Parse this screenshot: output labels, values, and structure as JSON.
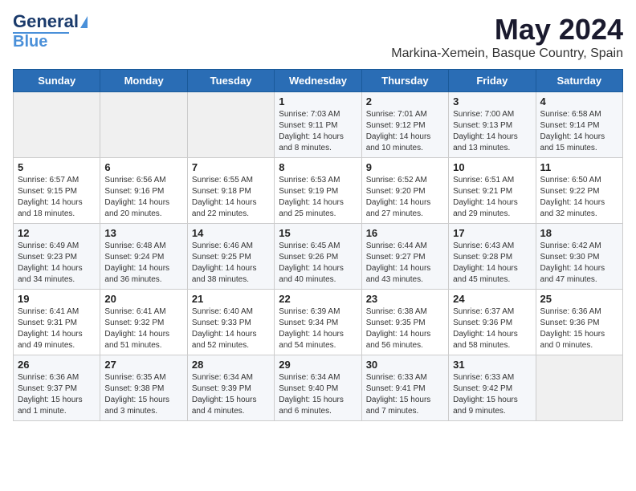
{
  "logo": {
    "line1": "General",
    "line2": "Blue"
  },
  "title": "May 2024",
  "subtitle": "Markina-Xemein, Basque Country, Spain",
  "days_header": [
    "Sunday",
    "Monday",
    "Tuesday",
    "Wednesday",
    "Thursday",
    "Friday",
    "Saturday"
  ],
  "weeks": [
    [
      {
        "day": "",
        "info": ""
      },
      {
        "day": "",
        "info": ""
      },
      {
        "day": "",
        "info": ""
      },
      {
        "day": "1",
        "info": "Sunrise: 7:03 AM\nSunset: 9:11 PM\nDaylight: 14 hours\nand 8 minutes."
      },
      {
        "day": "2",
        "info": "Sunrise: 7:01 AM\nSunset: 9:12 PM\nDaylight: 14 hours\nand 10 minutes."
      },
      {
        "day": "3",
        "info": "Sunrise: 7:00 AM\nSunset: 9:13 PM\nDaylight: 14 hours\nand 13 minutes."
      },
      {
        "day": "4",
        "info": "Sunrise: 6:58 AM\nSunset: 9:14 PM\nDaylight: 14 hours\nand 15 minutes."
      }
    ],
    [
      {
        "day": "5",
        "info": "Sunrise: 6:57 AM\nSunset: 9:15 PM\nDaylight: 14 hours\nand 18 minutes."
      },
      {
        "day": "6",
        "info": "Sunrise: 6:56 AM\nSunset: 9:16 PM\nDaylight: 14 hours\nand 20 minutes."
      },
      {
        "day": "7",
        "info": "Sunrise: 6:55 AM\nSunset: 9:18 PM\nDaylight: 14 hours\nand 22 minutes."
      },
      {
        "day": "8",
        "info": "Sunrise: 6:53 AM\nSunset: 9:19 PM\nDaylight: 14 hours\nand 25 minutes."
      },
      {
        "day": "9",
        "info": "Sunrise: 6:52 AM\nSunset: 9:20 PM\nDaylight: 14 hours\nand 27 minutes."
      },
      {
        "day": "10",
        "info": "Sunrise: 6:51 AM\nSunset: 9:21 PM\nDaylight: 14 hours\nand 29 minutes."
      },
      {
        "day": "11",
        "info": "Sunrise: 6:50 AM\nSunset: 9:22 PM\nDaylight: 14 hours\nand 32 minutes."
      }
    ],
    [
      {
        "day": "12",
        "info": "Sunrise: 6:49 AM\nSunset: 9:23 PM\nDaylight: 14 hours\nand 34 minutes."
      },
      {
        "day": "13",
        "info": "Sunrise: 6:48 AM\nSunset: 9:24 PM\nDaylight: 14 hours\nand 36 minutes."
      },
      {
        "day": "14",
        "info": "Sunrise: 6:46 AM\nSunset: 9:25 PM\nDaylight: 14 hours\nand 38 minutes."
      },
      {
        "day": "15",
        "info": "Sunrise: 6:45 AM\nSunset: 9:26 PM\nDaylight: 14 hours\nand 40 minutes."
      },
      {
        "day": "16",
        "info": "Sunrise: 6:44 AM\nSunset: 9:27 PM\nDaylight: 14 hours\nand 43 minutes."
      },
      {
        "day": "17",
        "info": "Sunrise: 6:43 AM\nSunset: 9:28 PM\nDaylight: 14 hours\nand 45 minutes."
      },
      {
        "day": "18",
        "info": "Sunrise: 6:42 AM\nSunset: 9:30 PM\nDaylight: 14 hours\nand 47 minutes."
      }
    ],
    [
      {
        "day": "19",
        "info": "Sunrise: 6:41 AM\nSunset: 9:31 PM\nDaylight: 14 hours\nand 49 minutes."
      },
      {
        "day": "20",
        "info": "Sunrise: 6:41 AM\nSunset: 9:32 PM\nDaylight: 14 hours\nand 51 minutes."
      },
      {
        "day": "21",
        "info": "Sunrise: 6:40 AM\nSunset: 9:33 PM\nDaylight: 14 hours\nand 52 minutes."
      },
      {
        "day": "22",
        "info": "Sunrise: 6:39 AM\nSunset: 9:34 PM\nDaylight: 14 hours\nand 54 minutes."
      },
      {
        "day": "23",
        "info": "Sunrise: 6:38 AM\nSunset: 9:35 PM\nDaylight: 14 hours\nand 56 minutes."
      },
      {
        "day": "24",
        "info": "Sunrise: 6:37 AM\nSunset: 9:36 PM\nDaylight: 14 hours\nand 58 minutes."
      },
      {
        "day": "25",
        "info": "Sunrise: 6:36 AM\nSunset: 9:36 PM\nDaylight: 15 hours\nand 0 minutes."
      }
    ],
    [
      {
        "day": "26",
        "info": "Sunrise: 6:36 AM\nSunset: 9:37 PM\nDaylight: 15 hours\nand 1 minute."
      },
      {
        "day": "27",
        "info": "Sunrise: 6:35 AM\nSunset: 9:38 PM\nDaylight: 15 hours\nand 3 minutes."
      },
      {
        "day": "28",
        "info": "Sunrise: 6:34 AM\nSunset: 9:39 PM\nDaylight: 15 hours\nand 4 minutes."
      },
      {
        "day": "29",
        "info": "Sunrise: 6:34 AM\nSunset: 9:40 PM\nDaylight: 15 hours\nand 6 minutes."
      },
      {
        "day": "30",
        "info": "Sunrise: 6:33 AM\nSunset: 9:41 PM\nDaylight: 15 hours\nand 7 minutes."
      },
      {
        "day": "31",
        "info": "Sunrise: 6:33 AM\nSunset: 9:42 PM\nDaylight: 15 hours\nand 9 minutes."
      },
      {
        "day": "",
        "info": ""
      }
    ]
  ]
}
